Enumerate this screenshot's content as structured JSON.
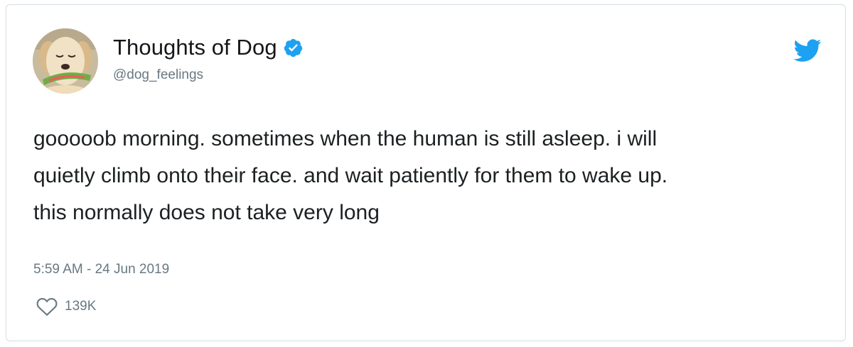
{
  "tweet": {
    "author": {
      "display_name": "Thoughts of Dog",
      "handle": "@dog_feelings",
      "verified": true,
      "avatar_icon": "dog-avatar"
    },
    "text_lines": [
      "gooooob morning. sometimes when the human is still asleep. i will",
      "quietly climb onto their face. and wait patiently for them to wake up.",
      "this normally does not take very long"
    ],
    "timestamp": "5:59 AM - 24 Jun 2019",
    "likes": {
      "icon": "heart-icon",
      "count": "139K"
    },
    "brand_icon": "twitter-bird-icon"
  },
  "colors": {
    "brand_blue": "#1da1f2",
    "verified_blue": "#1da1f2",
    "text_primary": "#1c2022",
    "text_secondary": "#697882",
    "border": "#d6dde3"
  }
}
